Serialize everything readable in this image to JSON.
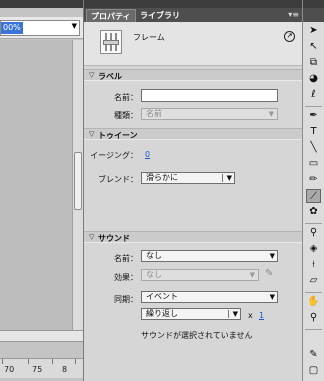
{
  "stage": {
    "zoom_value": "00%",
    "ruler_ticks": [
      "70",
      "75",
      "8"
    ]
  },
  "panel": {
    "tabs": [
      "プロパティ",
      "ライブラリ"
    ],
    "frame_label": "フレーム",
    "label_section": {
      "title": "ラベル",
      "name_label": "名前：",
      "name_value": "",
      "type_label": "種類：",
      "type_value": "名前"
    },
    "tween_section": {
      "title": "トゥイーン",
      "easing_label": "イージング：",
      "easing_value": "0",
      "blend_label": "ブレンド：",
      "blend_value": "滑らかに"
    },
    "sound_section": {
      "title": "サウンド",
      "name_label": "名前：",
      "name_value": "なし",
      "effect_label": "効果：",
      "effect_value": "なし",
      "sync_label": "同期：",
      "sync_value": "イベント",
      "repeat_value": "繰り返し",
      "repeat_x": "x",
      "repeat_count": "1",
      "status": "サウンドが選択されていません"
    }
  },
  "tools": [
    "selection-tool",
    "subselection-tool",
    "free-transform-tool",
    "3d-rotation-tool",
    "lasso-tool",
    "pen-tool",
    "text-tool",
    "line-tool",
    "rectangle-tool",
    "pencil-tool",
    "brush-tool",
    "deco-tool",
    "bone-tool",
    "paint-bucket-tool",
    "eyedropper-tool",
    "eraser-tool",
    "hand-tool",
    "zoom-tool",
    "stroke-color-tool",
    "fill-color-tool"
  ]
}
